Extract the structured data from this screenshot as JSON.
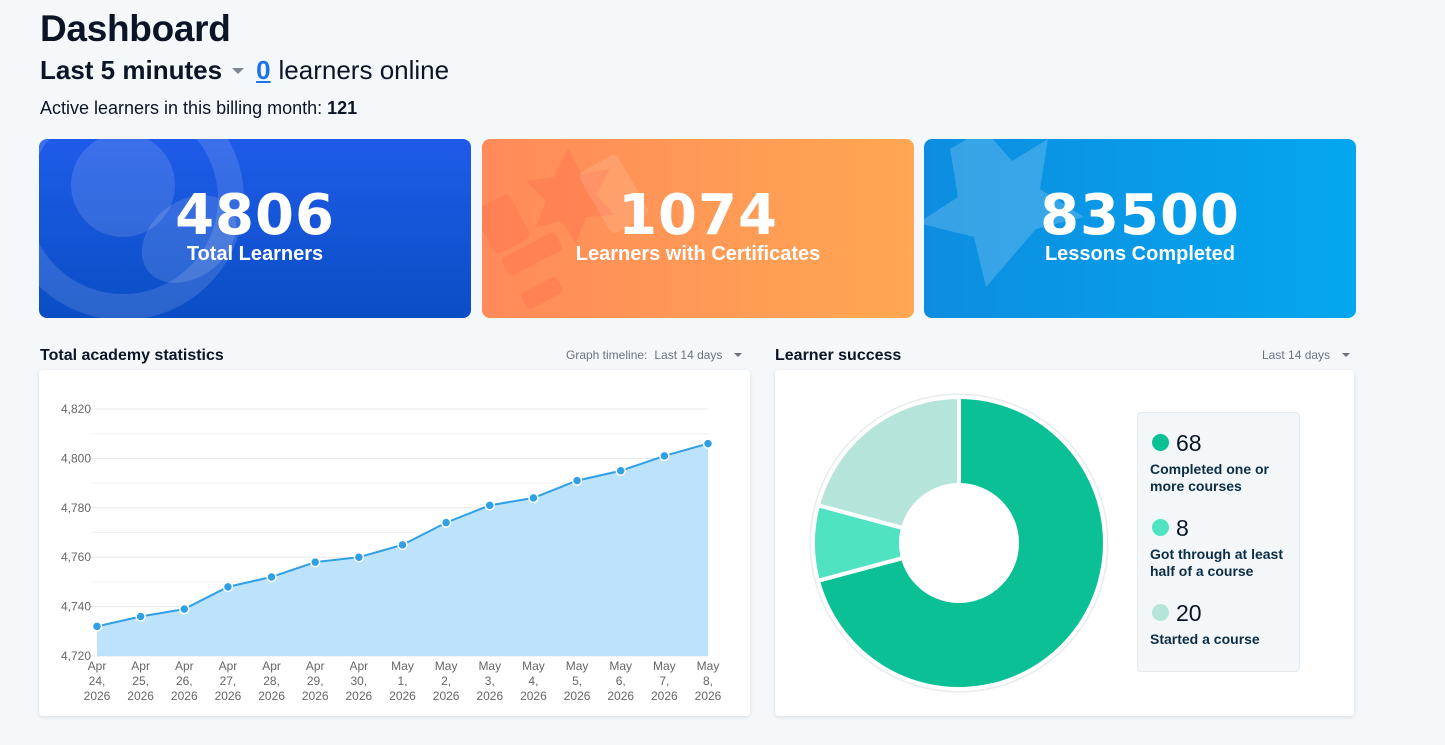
{
  "header": {
    "title": "Dashboard",
    "period": "Last 5 minutes",
    "online_count": "0",
    "online_text": "learners online",
    "billing_label": "Active learners in this billing month:",
    "billing_value": "121"
  },
  "cards": [
    {
      "value": "4806",
      "label": "Total Learners",
      "icon": "user-icon",
      "color": "#1f5be9"
    },
    {
      "value": "1074",
      "label": "Learners with Certificates",
      "icon": "certificate-icon",
      "color": "#ff9656"
    },
    {
      "value": "83500",
      "label": "Lessons Completed",
      "icon": "star-icon",
      "color": "#04a0ea"
    }
  ],
  "stats": {
    "title": "Total academy statistics",
    "timeline_label": "Graph timeline:",
    "timeline_value": "Last 14 days"
  },
  "success": {
    "title": "Learner success",
    "timeline_value": "Last 14 days"
  },
  "chart_data": [
    {
      "type": "area",
      "x": [
        "Apr 24, 2026",
        "Apr 25, 2026",
        "Apr 26, 2026",
        "Apr 27, 2026",
        "Apr 28, 2026",
        "Apr 29, 2026",
        "Apr 30, 2026",
        "May 1, 2026",
        "May 2, 2026",
        "May 3, 2026",
        "May 4, 2026",
        "May 5, 2026",
        "May 6, 2026",
        "May 7, 2026",
        "May 8, 2026"
      ],
      "x_tick_lines": [
        [
          "Apr",
          "24,",
          "2026"
        ],
        [
          "Apr",
          "25,",
          "2026"
        ],
        [
          "Apr",
          "26,",
          "2026"
        ],
        [
          "Apr",
          "27,",
          "2026"
        ],
        [
          "Apr",
          "28,",
          "2026"
        ],
        [
          "Apr",
          "29,",
          "2026"
        ],
        [
          "Apr",
          "30,",
          "2026"
        ],
        [
          "May",
          "1,",
          "2026"
        ],
        [
          "May",
          "2,",
          "2026"
        ],
        [
          "May",
          "3,",
          "2026"
        ],
        [
          "May",
          "4,",
          "2026"
        ],
        [
          "May",
          "5,",
          "2026"
        ],
        [
          "May",
          "6,",
          "2026"
        ],
        [
          "May",
          "7,",
          "2026"
        ],
        [
          "May",
          "8,",
          "2026"
        ]
      ],
      "values": [
        4732,
        4736,
        4739,
        4748,
        4752,
        4758,
        4760,
        4765,
        4774,
        4781,
        4784,
        4791,
        4795,
        4801,
        4806
      ],
      "ylim": [
        4720,
        4820
      ],
      "y_ticks": [
        4720,
        4740,
        4760,
        4780,
        4800,
        4820
      ],
      "y_tick_labels": [
        "4,720",
        "4,740",
        "4,760",
        "4,780",
        "4,800",
        "4,820"
      ],
      "grid": true,
      "line_color": "#2f9fe6",
      "fill_color": "#b9e0fb"
    },
    {
      "type": "pie",
      "donut": true,
      "values": [
        68,
        8,
        20
      ],
      "labels": [
        "Completed one or more courses",
        "Got through at least half of a course",
        "Started a course"
      ],
      "colors": [
        "#0cc095",
        "#50e3c2",
        "#b5e5da"
      ]
    }
  ],
  "legend": [
    {
      "value": "68",
      "line1": "Completed one or",
      "line2": "more courses",
      "color": "#0cc095"
    },
    {
      "value": "8",
      "line1": "Got through at least",
      "line2": "half of a course",
      "color": "#50e3c2"
    },
    {
      "value": "20",
      "line1": "Started a course",
      "line2": "",
      "color": "#b5e5da"
    }
  ]
}
